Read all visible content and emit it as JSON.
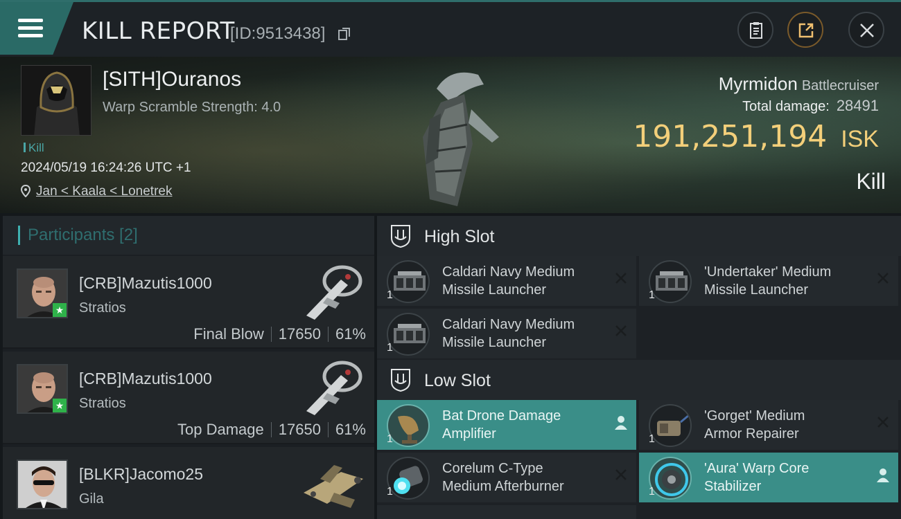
{
  "header": {
    "title": "KILL REPORT",
    "report_id": "[ID:9513438]",
    "icons": [
      "menu-icon",
      "copy-icon",
      "clipboard-icon",
      "share-icon",
      "close-icon"
    ]
  },
  "victim": {
    "name": "[SITH]Ouranos",
    "warp_scramble": "Warp Scramble Strength: 4.0",
    "tag": "Kill",
    "datetime": "2024/05/19 16:24:26 UTC +1",
    "location": "Jan < Kaala < Lonetrek",
    "ship_name": "Myrmidon",
    "ship_class": "Battlecruiser",
    "total_damage_label": "Total damage:",
    "total_damage": "28491",
    "isk_value": "191,251,194",
    "isk_unit": "ISK",
    "result": "Kill"
  },
  "participants": {
    "title": "Participants [2]",
    "rows": [
      {
        "name": "[CRB]Mazutis1000",
        "ship": "Stratios",
        "role": "Final Blow",
        "damage": "17650",
        "percent": "61%"
      },
      {
        "name": "[CRB]Mazutis1000",
        "ship": "Stratios",
        "role": "Top Damage",
        "damage": "17650",
        "percent": "61%"
      },
      {
        "name": "[BLKR]Jacomo25",
        "ship": "Gila"
      }
    ]
  },
  "fitting": {
    "high_slot": {
      "label": "High Slot",
      "modules": [
        {
          "line1": "Caldari Navy Medium",
          "line2": "Missile Launcher",
          "qty": "1"
        },
        {
          "line1": "'Undertaker' Medium",
          "line2": "Missile Launcher",
          "qty": "1"
        },
        {
          "line1": "Caldari Navy Medium",
          "line2": "Missile Launcher",
          "qty": "1"
        }
      ]
    },
    "low_slot": {
      "label": "Low Slot",
      "modules": [
        {
          "line1": "Bat Drone Damage",
          "line2": "Amplifier",
          "qty": "1"
        },
        {
          "line1": "'Gorget' Medium",
          "line2": "Armor Repairer",
          "qty": "1"
        },
        {
          "line1": "Corelum C-Type",
          "line2": "Medium Afterburner",
          "qty": "1"
        },
        {
          "line1": "'Aura' Warp Core",
          "line2": "Stabilizer",
          "qty": "1"
        }
      ]
    }
  },
  "colors": {
    "accent": "#3a8e88",
    "isk": "#f3cf7a",
    "header_teal": "#2a6a66"
  }
}
